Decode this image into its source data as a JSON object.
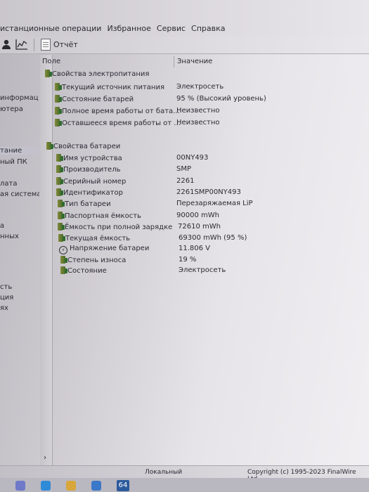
{
  "menu": [
    "истанционные операции",
    "Избранное",
    "Сервис",
    "Справка"
  ],
  "toolbar": {
    "report_label": "Отчёт",
    "icons": [
      "user-icon",
      "chart-icon",
      "report-icon"
    ]
  },
  "left_panel": [
    "информац",
    "ютера",
    "тание",
    "ный ПК",
    "лата",
    "ая система",
    "а",
    "нных",
    "сть",
    "ция",
    "ях"
  ],
  "columns": {
    "field": "Поле",
    "value": "Значение"
  },
  "power_section": {
    "title": "Свойства электропитания",
    "rows": [
      {
        "field": "Текущий источник питания",
        "value": "Электросеть"
      },
      {
        "field": "Состояние батарей",
        "value": "95 % (Высокий уровень)"
      },
      {
        "field": "Полное время работы от бата...",
        "value": "Неизвестно"
      },
      {
        "field": "Оставшееся время работы от ...",
        "value": "Неизвестно"
      }
    ]
  },
  "battery_section": {
    "title": "Свойства батареи",
    "rows": [
      {
        "field": "Имя устройства",
        "value": "00NY493"
      },
      {
        "field": "Производитель",
        "value": "SMP"
      },
      {
        "field": "Серийный номер",
        "value": "2261"
      },
      {
        "field": "Идентификатор",
        "value": "2261SMP00NY493"
      },
      {
        "field": "Тип батареи",
        "value": "Перезаряжаемая LiP"
      },
      {
        "field": "Паспортная ёмкость",
        "value": "90000 mWh"
      },
      {
        "field": "Ёмкость при полной зарядке",
        "value": "72610 mWh"
      },
      {
        "field": "Текущая ёмкость",
        "value": "69300 mWh  (95 %)"
      },
      {
        "field": "Напряжение батареи",
        "value": "11.806 V"
      },
      {
        "field": "Степень износа",
        "value": "19 %"
      },
      {
        "field": "Состояние",
        "value": "Электросеть"
      }
    ]
  },
  "status": {
    "chevron": "›",
    "local": "Локальный",
    "copyright": "Copyright (c) 1995-2023 FinalWire Ltd."
  },
  "taskbar": {
    "badge": "64"
  }
}
